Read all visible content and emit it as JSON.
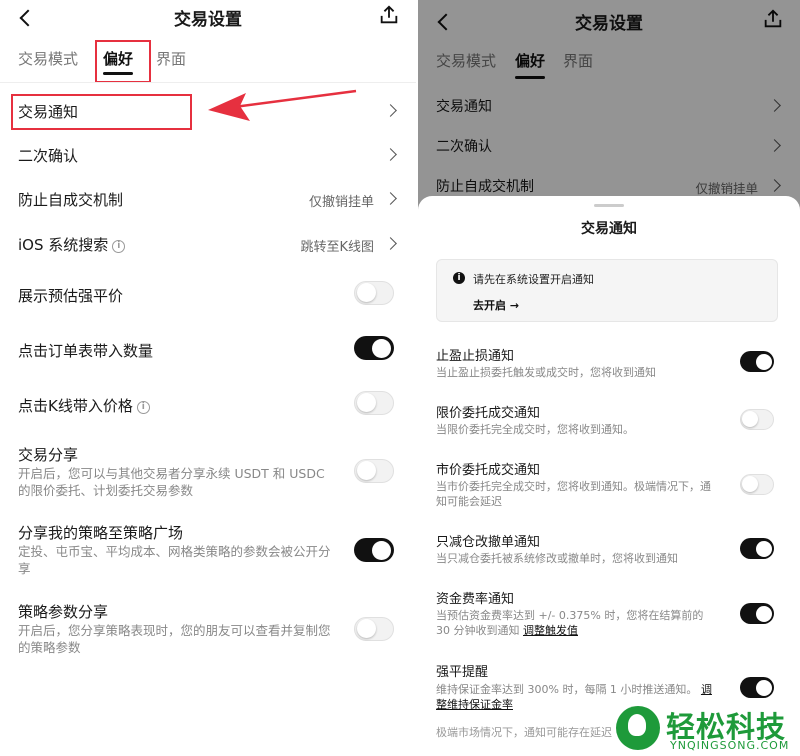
{
  "left": {
    "title": "交易设置",
    "tabs": [
      "交易模式",
      "偏好",
      "界面"
    ],
    "active_tab": "偏好",
    "rows": [
      {
        "label": "交易通知"
      },
      {
        "label": "二次确认"
      },
      {
        "label": "防止自成交机制",
        "value": "仅撤销挂单"
      },
      {
        "label": "iOS 系统搜索",
        "value": "跳转至K线图"
      },
      {
        "label": "展示预估强平价",
        "toggle": "off"
      },
      {
        "label": "点击订单表带入数量",
        "toggle": "on"
      },
      {
        "label": "点击K线带入价格",
        "toggle": "off"
      },
      {
        "label": "交易分享",
        "desc": "开启后，您可以与其他交易者分享永续 USDT 和 USDC 的限价委托、计划委托交易参数",
        "toggle": "off"
      },
      {
        "label": "分享我的策略至策略广场",
        "desc": "定投、屯币宝、平均成本、网格类策略的参数会被公开分享",
        "toggle": "on"
      },
      {
        "label": "策略参数分享",
        "desc": "开启后，您分享策略表现时，您的朋友可以查看并复制您的策略参数",
        "toggle": "off"
      }
    ]
  },
  "right": {
    "title": "交易设置",
    "tabs": [
      "交易模式",
      "偏好",
      "界面"
    ],
    "dim_rows": [
      {
        "label": "交易通知"
      },
      {
        "label": "二次确认"
      },
      {
        "label": "防止自成交机制",
        "value": "仅撤销挂单"
      }
    ],
    "sheet": {
      "title": "交易通知",
      "notice_text": "请先在系统设置开启通知",
      "notice_link": "去开启 →",
      "items": [
        {
          "label": "止盈止损通知",
          "desc": "当止盈止损委托触发或成交时，您将收到通知",
          "toggle": "on"
        },
        {
          "label": "限价委托成交通知",
          "desc": "当限价委托完全成交时，您将收到通知。",
          "toggle": "off"
        },
        {
          "label": "市价委托成交通知",
          "desc": "当市价委托完全成交时，您将收到通知。极端情况下，通知可能会延迟",
          "toggle": "off"
        },
        {
          "label": "只减仓改撤单通知",
          "desc": "当只减仓委托被系统修改或撤单时，您将收到通知",
          "toggle": "on"
        },
        {
          "label": "资金费率通知",
          "desc": "当预估资金费率达到 +/- 0.375% 时，您将在结算前的 30 分钟收到通知",
          "link": "调整触发值",
          "toggle": "on"
        },
        {
          "label": "强平提醒",
          "desc": "维持保证金率达到 300% 时，每隔 1 小时推送通知。",
          "link": "调整维持保证金率",
          "toggle": "on"
        }
      ],
      "footnote": "极端市场情况下，通知可能存在延迟"
    }
  },
  "watermark": {
    "text": "轻松科技",
    "sub": "YNQINGSONG.COM"
  },
  "colors": {
    "highlight": "#e6303f",
    "toggle_on": "#111111",
    "watermark": "#1e9a3a"
  }
}
